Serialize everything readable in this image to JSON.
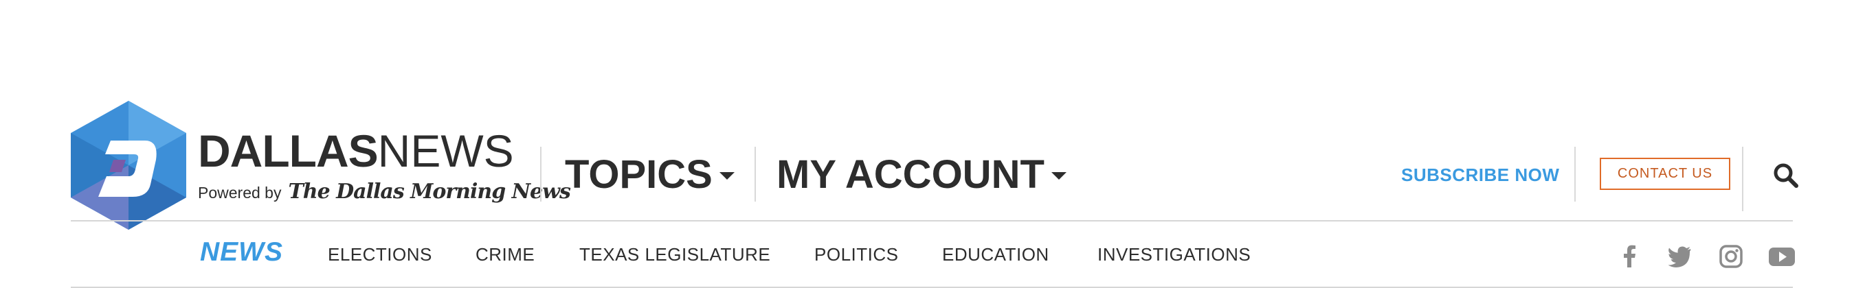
{
  "brand": {
    "name_bold": "DALLAS",
    "name_light": "NEWS",
    "powered_by": "Powered by",
    "parent_paper": "The Dallas Morning News",
    "logo_color": "#3a8fd6"
  },
  "main_nav": {
    "topics_label": "TOPICS",
    "account_label": "MY ACCOUNT"
  },
  "actions": {
    "subscribe_label": "SUBSCRIBE NOW",
    "contact_label": "CONTACT US",
    "search_icon": "search-icon"
  },
  "section_nav": {
    "current_section": "NEWS",
    "items": [
      {
        "label": "ELECTIONS"
      },
      {
        "label": "CRIME"
      },
      {
        "label": "TEXAS LEGISLATURE"
      },
      {
        "label": "POLITICS"
      },
      {
        "label": "EDUCATION"
      },
      {
        "label": "INVESTIGATIONS"
      }
    ]
  },
  "social": [
    {
      "icon": "facebook-icon"
    },
    {
      "icon": "twitter-icon"
    },
    {
      "icon": "instagram-icon"
    },
    {
      "icon": "youtube-icon"
    }
  ],
  "colors": {
    "accent_blue": "#3a9ae0",
    "contact_orange": "#e06b28",
    "text_dark": "#2d2d2d",
    "social_gray": "#8c8c8c"
  }
}
